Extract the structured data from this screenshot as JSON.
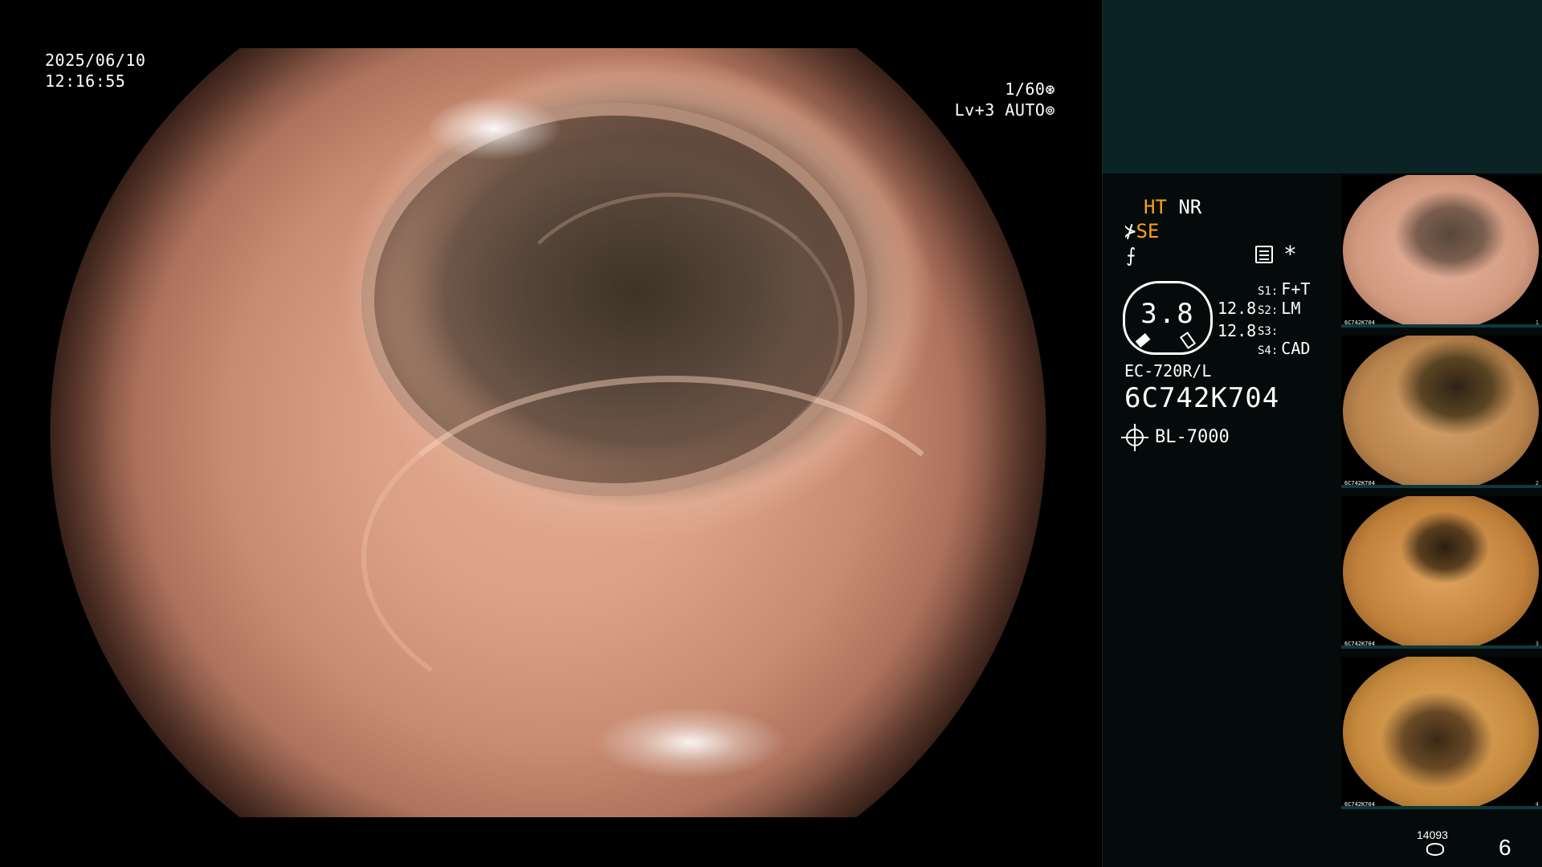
{
  "overlay": {
    "date": "2025/06/10",
    "time": "12:16:55",
    "shutter": "1/60",
    "shutter_icon": "aperture-icon",
    "level": "Lv+3 AUTO",
    "auto_icon": "auto-exposure-icon"
  },
  "panel": {
    "ht": "HT",
    "nr": "NR",
    "se": "SE",
    "se_icon": "structure-enhance-icon",
    "f_icon": "color-mode-icon",
    "menu_icon": "settings-list-icon",
    "asterisk": "*",
    "dial_value": "3.8",
    "gain_1": "12.8",
    "gain_2": "12.8",
    "switches": [
      {
        "label": "S1:",
        "value": "F+T"
      },
      {
        "label": "S2:",
        "value": "LM"
      },
      {
        "label": "S3:",
        "value": ""
      },
      {
        "label": "S4:",
        "value": "CAD"
      }
    ],
    "scope_model": "EC-720R/L",
    "serial": "6C742K704",
    "light_source": "BL-7000",
    "light_icon": "light-source-icon"
  },
  "thumbnails": [
    {
      "label": "6C742K704",
      "index": "1"
    },
    {
      "label": "6C742K704",
      "index": "2"
    },
    {
      "label": "6C742K704",
      "index": "3"
    },
    {
      "label": "6C742K704",
      "index": "4"
    }
  ],
  "footer": {
    "storage_count": "14093",
    "storage_icon": "database-icon",
    "page": "6"
  },
  "colors": {
    "accent_orange": "#f6a21b",
    "panel_top": "#0a2426",
    "panel_body": "#050a0b"
  }
}
